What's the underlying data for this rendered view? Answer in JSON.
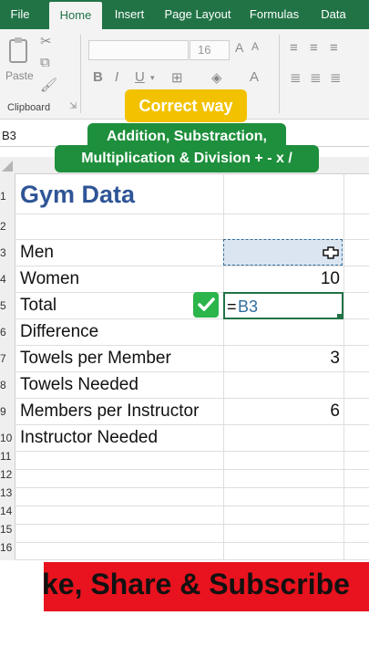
{
  "ribbon": {
    "tabs": [
      "File",
      "Home",
      "Insert",
      "Page Layout",
      "Formulas",
      "Data"
    ],
    "active_tab": "Home",
    "paste_label": "Paste",
    "clipboard_label": "Clipboard",
    "font_size": "16",
    "bold": "B",
    "italic": "I",
    "underline": "U",
    "font_color": "A"
  },
  "name_box": "B3",
  "callouts": {
    "correct_way": "Correct way",
    "line1": "Addition, Substraction,",
    "line2": "Multiplication & Division +  -  x  /"
  },
  "rows": [
    "1",
    "2",
    "3",
    "4",
    "5",
    "6",
    "7",
    "8",
    "9",
    "10",
    "11",
    "12",
    "13",
    "14",
    "15",
    "16"
  ],
  "sheet": {
    "title": "Gym Data",
    "labels": {
      "men": "Men",
      "women": "Women",
      "total": "Total",
      "difference": "Difference",
      "towels_per_member": "Towels per Member",
      "towels_needed": "Towels Needed",
      "members_per_instructor": "Members per Instructor",
      "instructor_needed": "Instructor Needed"
    },
    "values": {
      "women": "10",
      "towels_per_member": "3",
      "members_per_instructor": "6"
    },
    "editing_formula": "=B3"
  },
  "banner_text": "ke, Share & Subscribe",
  "colors": {
    "excel_green": "#217346",
    "title_blue": "#2f5597",
    "callout_yellow": "#f2c200",
    "callout_green": "#1e8f3c",
    "banner_red": "#e8131e"
  }
}
